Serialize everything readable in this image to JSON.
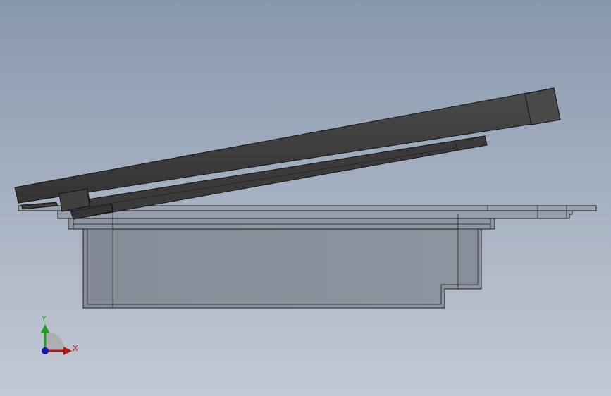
{
  "viewport": {
    "background_top": "#8797ad",
    "background_bottom": "#c2c9d4"
  },
  "model": {
    "lid_color": "#3d3d3e",
    "lid_edge": "#1a1a1a",
    "frame_color": "#959cab",
    "box_color": "#8a909b",
    "line_color": "#1e1e1e"
  },
  "triad": {
    "y_label": "Y",
    "x_label": "X",
    "y_color": "#1fa11f",
    "x_color": "#b01818",
    "z_color": "#1a1aa8"
  }
}
